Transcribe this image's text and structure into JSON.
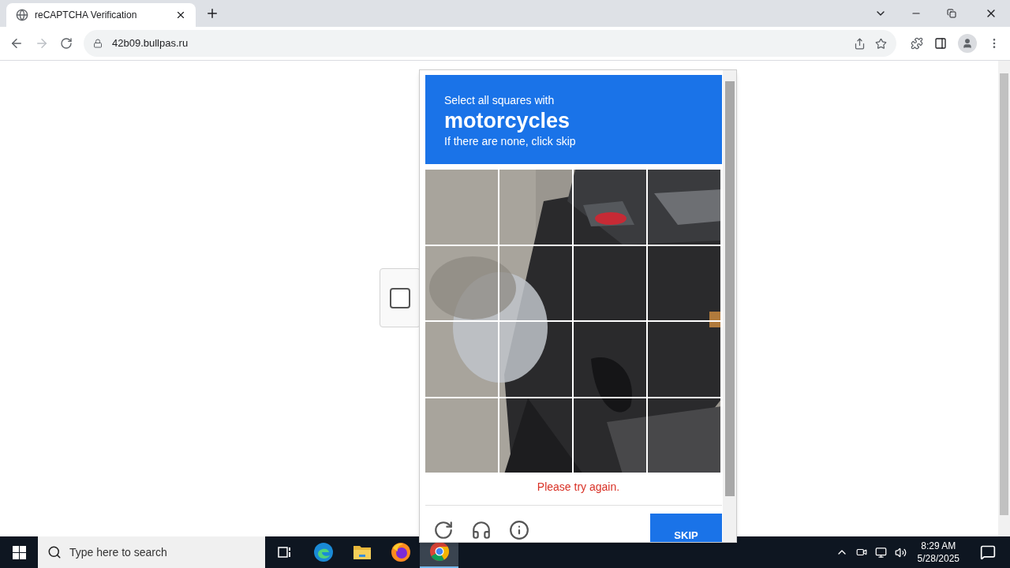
{
  "browser": {
    "tab": {
      "title": "reCAPTCHA Verification"
    },
    "address": "42b09.bullpas.ru"
  },
  "captcha": {
    "checkbox": {
      "checked": false
    },
    "challenge": {
      "prompt": "Select all squares with",
      "target": "motorcycles",
      "hint": "If there are none, click skip",
      "error": "Please try again.",
      "button": "SKIP"
    }
  },
  "taskbar": {
    "search_placeholder": "Type here to search",
    "apps": [
      {
        "kind": "taskview",
        "selected": false
      },
      {
        "kind": "edge",
        "selected": false
      },
      {
        "kind": "folder",
        "selected": false
      },
      {
        "kind": "firefox",
        "selected": false
      },
      {
        "kind": "chrome",
        "selected": true
      }
    ],
    "time": "8:29 AM",
    "date": "5/28/2025"
  }
}
